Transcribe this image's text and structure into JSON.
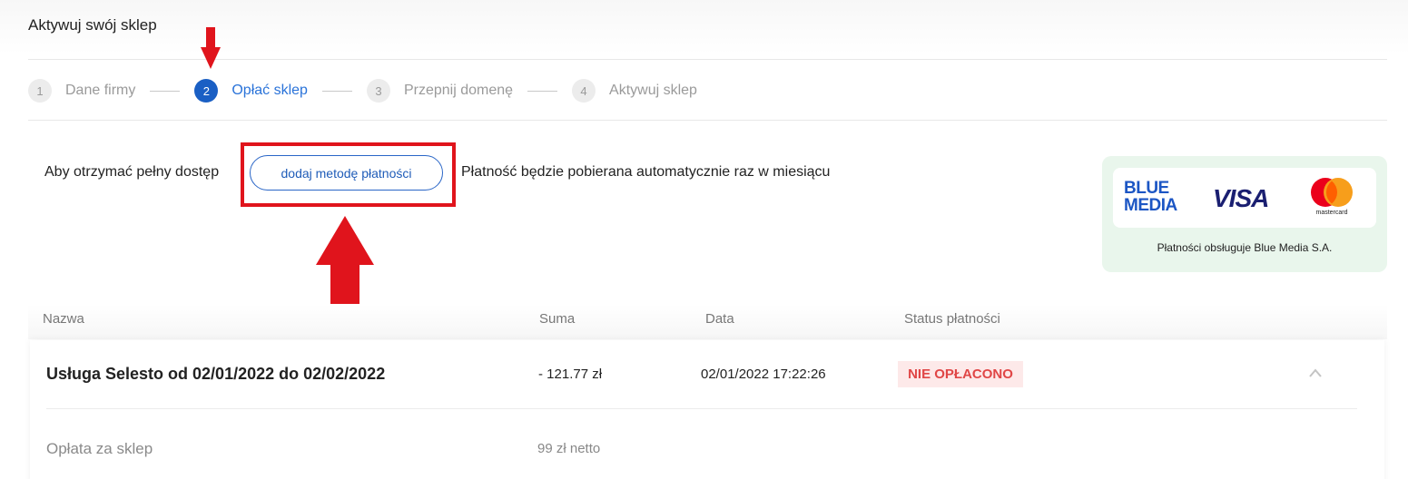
{
  "page": {
    "title": "Aktywuj swój sklep"
  },
  "stepper": {
    "steps": [
      {
        "number": "1",
        "label": "Dane firmy",
        "active": false
      },
      {
        "number": "2",
        "label": "Opłać sklep",
        "active": true
      },
      {
        "number": "3",
        "label": "Przepnij domenę",
        "active": false
      },
      {
        "number": "4",
        "label": "Aktywuj sklep",
        "active": false
      }
    ]
  },
  "payment": {
    "prefix_text": "Aby otrzymać pełny dostęp",
    "button_label": "dodaj metodę płatności",
    "suffix_text": "Płatność będzie pobierana automatycznie raz w miesiącu"
  },
  "payments_card": {
    "blue_media_logo": "BLUE MEDIA",
    "visa_logo": "VISA",
    "mastercard_logo": "mastercard",
    "caption": "Płatności obsługuje Blue Media S.A."
  },
  "table": {
    "headers": {
      "name": "Nazwa",
      "sum": "Suma",
      "date": "Data",
      "status": "Status płatności"
    },
    "rows": [
      {
        "name": "Usługa Selesto od 02/01/2022 do 02/02/2022",
        "sum": "- 121.77 zł",
        "date": "02/01/2022 17:22:26",
        "status": "NIE OPŁACONO",
        "details": [
          {
            "name": "Opłata za sklep",
            "sum": "99 zł netto"
          }
        ]
      }
    ]
  },
  "colors": {
    "accent": "#1a5fc4",
    "annotation_red": "#e0141c",
    "status_unpaid": "#e04646",
    "card_bg": "#e9f6ec"
  },
  "icons": {
    "collapse": "chevron-up-icon",
    "annotation": "red-arrow-icon"
  }
}
